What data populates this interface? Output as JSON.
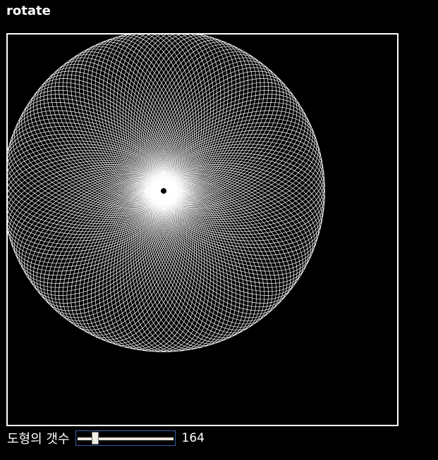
{
  "page": {
    "title": "rotate",
    "background": "#000000",
    "foreground": "#ffffff"
  },
  "canvas": {
    "pattern": "rotated-ellipses",
    "shape_count": 164
  },
  "controls": {
    "label": "도형의 갯수",
    "slider": {
      "value": 164,
      "min": 0,
      "max": 1000,
      "value_text": "164"
    }
  }
}
